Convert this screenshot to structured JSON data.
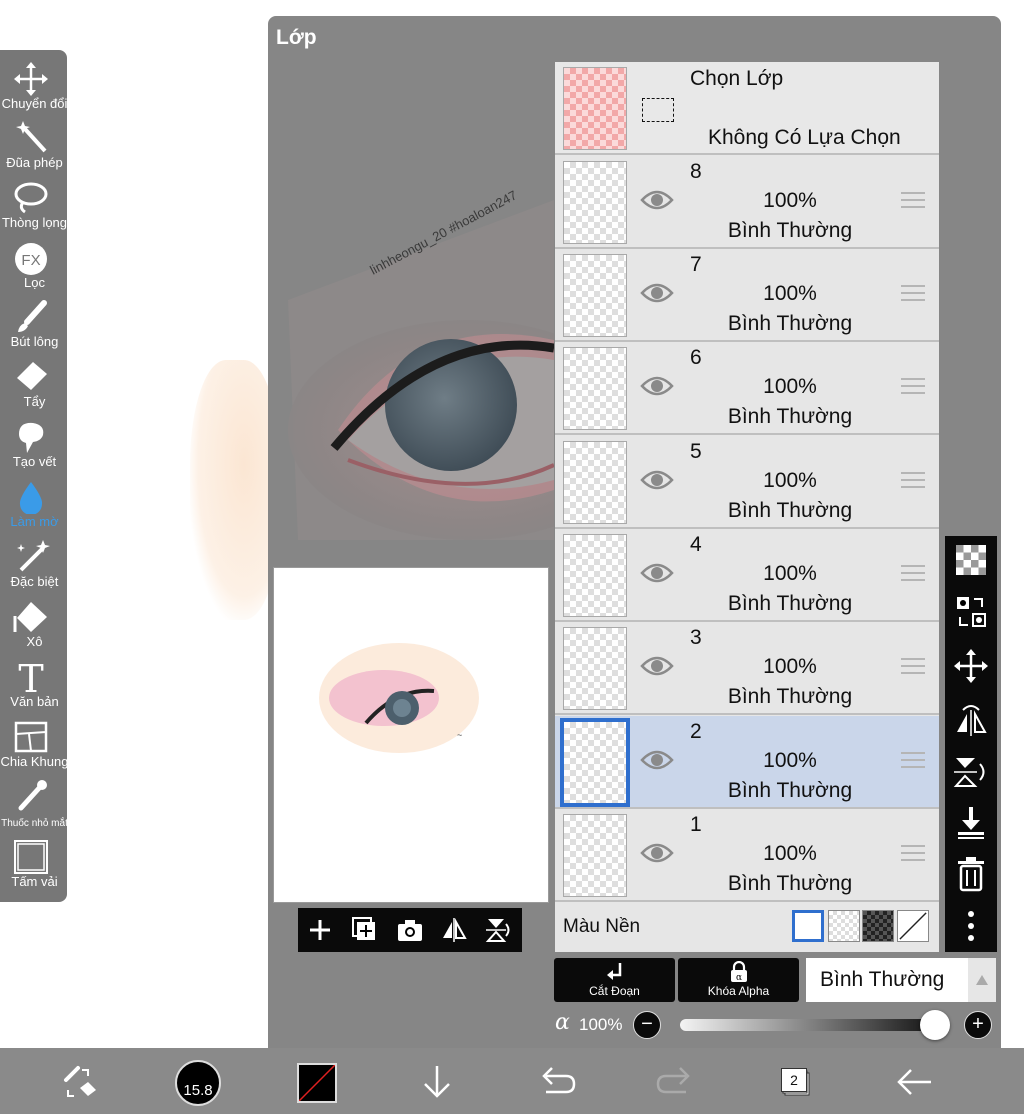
{
  "panel": {
    "title": "Lớp"
  },
  "toolbar": {
    "tools": [
      {
        "label": "Chuyển đổi",
        "icon": "move-icon"
      },
      {
        "label": "Đũa phép",
        "icon": "magic-wand-icon"
      },
      {
        "label": "Thòng lọng",
        "icon": "lasso-icon"
      },
      {
        "label": "Lọc",
        "icon": "fx-filter-icon"
      },
      {
        "label": "Bút lông",
        "icon": "brush-icon"
      },
      {
        "label": "Tẩy",
        "icon": "eraser-icon"
      },
      {
        "label": "Tạo vết",
        "icon": "smudge-icon"
      },
      {
        "label": "Làm mờ",
        "icon": "blur-drop-icon",
        "active": true
      },
      {
        "label": "Đặc biệt",
        "icon": "special-sparkle-icon"
      },
      {
        "label": "Xô",
        "icon": "bucket-icon"
      },
      {
        "label": "Văn bản",
        "icon": "text-icon"
      },
      {
        "label": "Chia Khung",
        "icon": "frame-divider-icon"
      },
      {
        "label": "Thuốc nhỏ mắt",
        "icon": "eyedropper-icon"
      },
      {
        "label": "Tấm vải",
        "icon": "canvas-icon"
      }
    ]
  },
  "selection": {
    "title": "Chọn Lớp",
    "status": "Không Có Lựa Chọn"
  },
  "layers": [
    {
      "number": "8",
      "opacity": "100%",
      "blend": "Bình Thường",
      "selected": false
    },
    {
      "number": "7",
      "opacity": "100%",
      "blend": "Bình Thường",
      "selected": false
    },
    {
      "number": "6",
      "opacity": "100%",
      "blend": "Bình Thường",
      "selected": false
    },
    {
      "number": "5",
      "opacity": "100%",
      "blend": "Bình Thường",
      "selected": false
    },
    {
      "number": "4",
      "opacity": "100%",
      "blend": "Bình Thường",
      "selected": false
    },
    {
      "number": "3",
      "opacity": "100%",
      "blend": "Bình Thường",
      "selected": false
    },
    {
      "number": "2",
      "opacity": "100%",
      "blend": "Bình Thường",
      "selected": true
    },
    {
      "number": "1",
      "opacity": "100%",
      "blend": "Bình Thường",
      "selected": false
    }
  ],
  "background": {
    "label": "Màu Nền"
  },
  "actions": {
    "clip_label": "Cắt Đoạn",
    "alpha_lock_label": "Khóa Alpha",
    "blend_mode": "Bình Thường"
  },
  "opacity": {
    "symbol": "α",
    "value": "100%",
    "level": 1.0
  },
  "bottom": {
    "brush_size": "15.8",
    "layer_count": "2"
  },
  "watermark": "linhheongu_20 #hoaloan247",
  "colors": {
    "accent": "#2f6fce",
    "active_tool": "#3a9be8",
    "panel": "#868686",
    "toolbar": "#777777"
  }
}
